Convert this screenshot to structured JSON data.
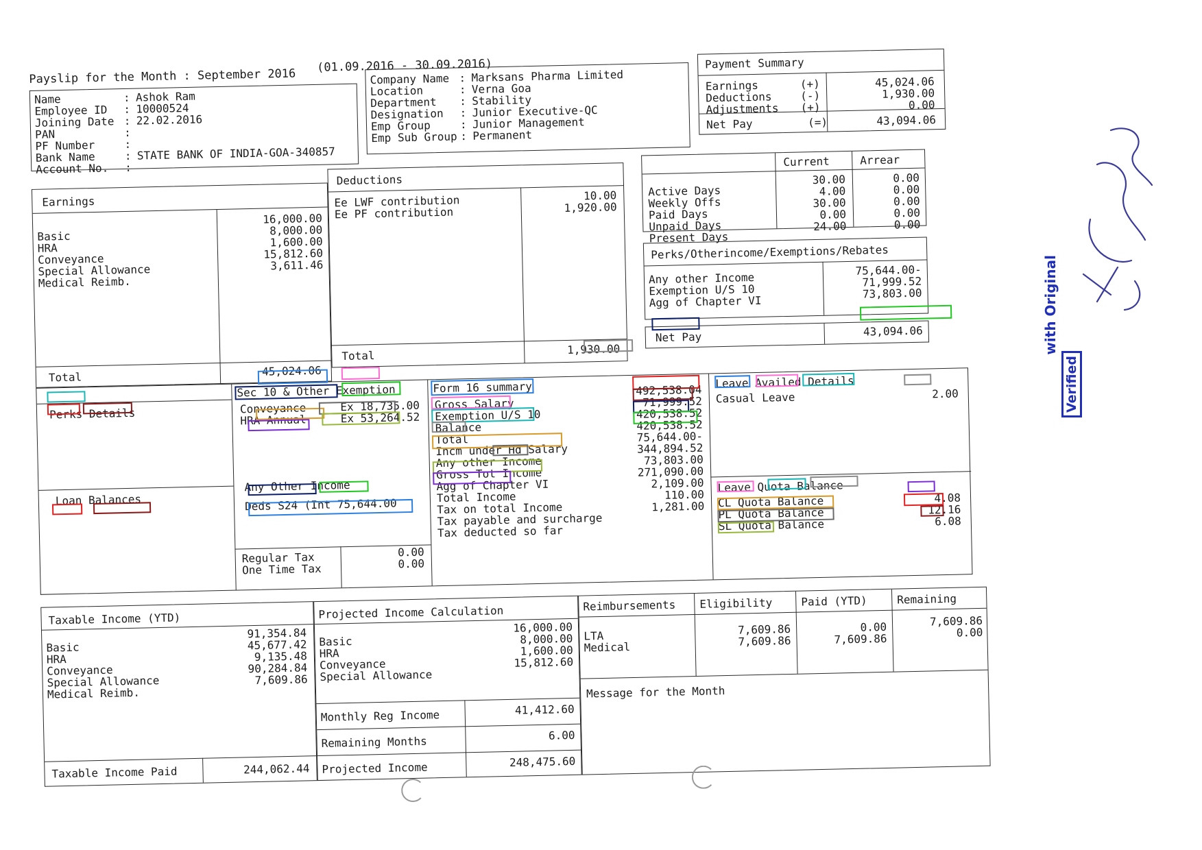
{
  "header": {
    "title": "Payslip for the Month : September 2016",
    "period": "(01.09.2016 - 30.09.2016)"
  },
  "employee": {
    "rows": [
      {
        "label": "Name",
        "sep": ":",
        "value": "Ashok Ram"
      },
      {
        "label": "Employee ID",
        "sep": ":",
        "value": "10000524"
      },
      {
        "label": "Joining Date",
        "sep": ":",
        "value": "22.02.2016"
      },
      {
        "label": "PAN",
        "sep": ":",
        "value": ""
      },
      {
        "label": "PF Number",
        "sep": ":",
        "value": ""
      },
      {
        "label": "Bank Name",
        "sep": ":",
        "value": "STATE BANK OF INDIA-GOA-340857"
      },
      {
        "label": "Account No.",
        "sep": ":",
        "value": ""
      }
    ]
  },
  "company": {
    "rows": [
      {
        "label": "Company Name",
        "sep": ":",
        "value": "Marksans Pharma Limited"
      },
      {
        "label": "Location",
        "sep": ":",
        "value": "Verna Goa"
      },
      {
        "label": "Department",
        "sep": ":",
        "value": "Stability"
      },
      {
        "label": "Designation",
        "sep": ":",
        "value": "Junior Executive-QC"
      },
      {
        "label": "Emp Group",
        "sep": ":",
        "value": "Junior Management"
      },
      {
        "label": "Emp Sub Group",
        "sep": ":",
        "value": "Permanent"
      }
    ]
  },
  "payment_summary": {
    "title": "Payment Summary",
    "rows": [
      {
        "label": "Earnings",
        "sign": "(+)",
        "value": "45,024.06"
      },
      {
        "label": "Deductions",
        "sign": "(-)",
        "value": "1,930.00"
      },
      {
        "label": "Adjustments",
        "sign": "(+)",
        "value": "0.00"
      }
    ],
    "net": {
      "label": "Net Pay",
      "sign": "(=)",
      "value": "43,094.06"
    }
  },
  "earnings": {
    "title": "Earnings",
    "rows": [
      {
        "label": "Basic",
        "value": "16,000.00"
      },
      {
        "label": "HRA",
        "value": "8,000.00"
      },
      {
        "label": "Conveyance",
        "value": "1,600.00"
      },
      {
        "label": "Special Allowance",
        "value": "15,812.60"
      },
      {
        "label": "Medical Reimb.",
        "value": "3,611.46"
      }
    ],
    "total_label": "Total",
    "total_value": "45,024.06"
  },
  "deductions": {
    "title": "Deductions",
    "rows": [
      {
        "label": "Ee LWF contribution",
        "value": "10.00"
      },
      {
        "label": "Ee PF contribution",
        "value": "1,920.00"
      }
    ],
    "total_label": "Total",
    "total_value": "1,930.00"
  },
  "attendance": {
    "col_current": "Current",
    "col_arrear": "Arrear",
    "rows": [
      {
        "label": "Active Days",
        "current": "30.00",
        "arrear": "0.00"
      },
      {
        "label": "Weekly Offs",
        "current": "4.00",
        "arrear": "0.00"
      },
      {
        "label": "Paid Days",
        "current": "30.00",
        "arrear": "0.00"
      },
      {
        "label": "Unpaid Days",
        "current": "0.00",
        "arrear": "0.00"
      },
      {
        "label": "Present Days",
        "current": "24.00",
        "arrear": "0.00"
      }
    ]
  },
  "perks_box": {
    "title": "Perks/Otherincome/Exemptions/Rebates",
    "rows": [
      {
        "label": "Any other Income",
        "value": "75,644.00-"
      },
      {
        "label": "Exemption U/S 10",
        "value": "71,999.52"
      },
      {
        "label": "Agg of Chapter VI",
        "value": "73,803.00"
      }
    ]
  },
  "net_pay_row": {
    "label": "Net Pay",
    "value": "43,094.06"
  },
  "perks_details": {
    "title": "Perks Details",
    "loan_title": "Loan Balances"
  },
  "sec10": {
    "title": "Sec 10 & Other Exemption",
    "rows": [
      {
        "label": "Conveyance",
        "value": "Ex 18,735.00"
      },
      {
        "label": "HRA Annual",
        "value": "Ex 53,264.52"
      }
    ],
    "other_income_title": "Any Other Income",
    "deds_line": "Deds S24 (Int 75,644.00",
    "tax_rows": [
      {
        "label": "Regular Tax",
        "value": "0.00"
      },
      {
        "label": "One Time Tax",
        "value": "0.00"
      }
    ]
  },
  "form16": {
    "title": "Form 16 summary",
    "rows": [
      {
        "label": "Gross Salary",
        "value": "492,538.04"
      },
      {
        "label": "Exemption U/S 10",
        "value": "71,999.52"
      },
      {
        "label": "Balance",
        "value": "420,538.52"
      },
      {
        "label": "Total",
        "value": "420,538.52"
      },
      {
        "label": "Incm under Hd Salary",
        "value": "75,644.00-"
      },
      {
        "label": "Any other Income",
        "value": "344,894.52"
      },
      {
        "label": "Gross Tot Income",
        "value": "73,803.00"
      },
      {
        "label": "Agg of Chapter VI",
        "value": "271,090.00"
      },
      {
        "label": "Total Income",
        "value": "2,109.00"
      },
      {
        "label": "Tax on total Income",
        "value": "110.00"
      },
      {
        "label": "Tax payable and surcharge",
        "value": ""
      },
      {
        "label": "Tax deducted so far",
        "value": "1,281.00"
      }
    ]
  },
  "leave": {
    "title": "Leave Availed Details",
    "availed_rows": [
      {
        "label": "Casual Leave",
        "value": "2.00"
      }
    ],
    "balance_title": "Leave Quota Balance",
    "balance_rows": [
      {
        "label": "CL Quota Balance",
        "value": "4.08"
      },
      {
        "label": "PL Quota Balance",
        "value": "12.16"
      },
      {
        "label": "SL Quota Balance",
        "value": "6.08"
      }
    ]
  },
  "taxable_ytd": {
    "title": "Taxable Income (YTD)",
    "rows": [
      {
        "label": "Basic",
        "value": "91,354.84"
      },
      {
        "label": "HRA",
        "value": "45,677.42"
      },
      {
        "label": "Conveyance",
        "value": "9,135.48"
      },
      {
        "label": "Special Allowance",
        "value": "90,284.84"
      },
      {
        "label": "Medical Reimb.",
        "value": "7,609.86"
      }
    ],
    "paid_label": "Taxable Income Paid",
    "paid_value": "244,062.44"
  },
  "projected": {
    "title": "Projected Income Calculation",
    "rows": [
      {
        "label": "Basic",
        "value": "16,000.00"
      },
      {
        "label": "HRA",
        "value": "8,000.00"
      },
      {
        "label": "Conveyance",
        "value": "1,600.00"
      },
      {
        "label": "Special Allowance",
        "value": "15,812.60"
      }
    ],
    "monthly_label": "Monthly Reg Income",
    "monthly_value": "41,412.60",
    "remaining_label": "Remaining Months",
    "remaining_value": "6.00",
    "projected_label": "Projected Income",
    "projected_value": "248,475.60"
  },
  "reimbursements": {
    "col_title": "Reimbursements",
    "col_eligibility": "Eligibility",
    "col_paid": "Paid (YTD)",
    "col_remaining": "Remaining",
    "rows": [
      {
        "label": "LTA",
        "eligibility": "7,609.86",
        "paid": "0.00",
        "remaining": "7,609.86"
      },
      {
        "label": "Medical",
        "eligibility": "7,609.86",
        "paid": "7,609.86",
        "remaining": "0.00"
      }
    ],
    "message_label": "Message for the Month"
  },
  "stamp": {
    "line1": "Verified",
    "line2": "with Original"
  },
  "handwriting": {
    "note": "Pulse 0 9652"
  },
  "highlight_colors": [
    "#e61e1e",
    "#8b1a1a",
    "#0b1f6b",
    "#1ec81e",
    "#2b7fe0",
    "#ff6ad5",
    "#18b7b7",
    "#8a8a8a",
    "#d89a2a",
    "#6a6a6a",
    "#98b83a",
    "#7a2ad6"
  ]
}
